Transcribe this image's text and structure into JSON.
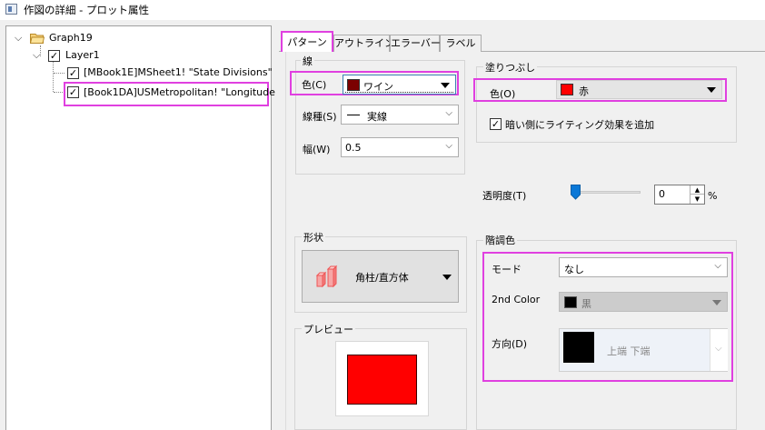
{
  "window": {
    "title": "作図の詳細 - プロット属性"
  },
  "tree": {
    "items": [
      {
        "label": "Graph19",
        "checked": false
      },
      {
        "label": "Layer1",
        "checked": true
      },
      {
        "label": "[MBook1E]MSheet1! \"State Divisions\"",
        "checked": true
      },
      {
        "label": "[Book1DA]USMetropolitan! \"Longitude",
        "checked": true
      }
    ]
  },
  "tabs": [
    {
      "label": "パターン"
    },
    {
      "label": "アウトライン"
    },
    {
      "label": "エラーバー"
    },
    {
      "label": "ラベル"
    }
  ],
  "line": {
    "group_title": "線",
    "color_label": "色(C)",
    "color_value": "ワイン",
    "color_hex": "#7b0000",
    "style_label": "線種(S)",
    "style_value": "実線",
    "width_label": "幅(W)",
    "width_value": "0.5"
  },
  "fill": {
    "group_title": "塗りつぶし",
    "color_label": "色(O)",
    "color_value": "赤",
    "color_hex": "#ff0000",
    "lighting_label": "暗い側にライティング効果を追加",
    "lighting_checked": true
  },
  "transparency": {
    "label": "透明度(T)",
    "value": "0",
    "unit": "%",
    "level": 0
  },
  "shape": {
    "group_title": "形状",
    "value": "角柱/直方体"
  },
  "gradient": {
    "group_title": "階調色",
    "mode_label": "モード",
    "mode_value": "なし",
    "color2_label": "2nd Color",
    "color2_value": "黒",
    "direction_label": "方向(D)",
    "direction_value": "上端 下端"
  },
  "preview": {
    "group_title": "プレビュー",
    "fill_hex": "#ff0000"
  }
}
